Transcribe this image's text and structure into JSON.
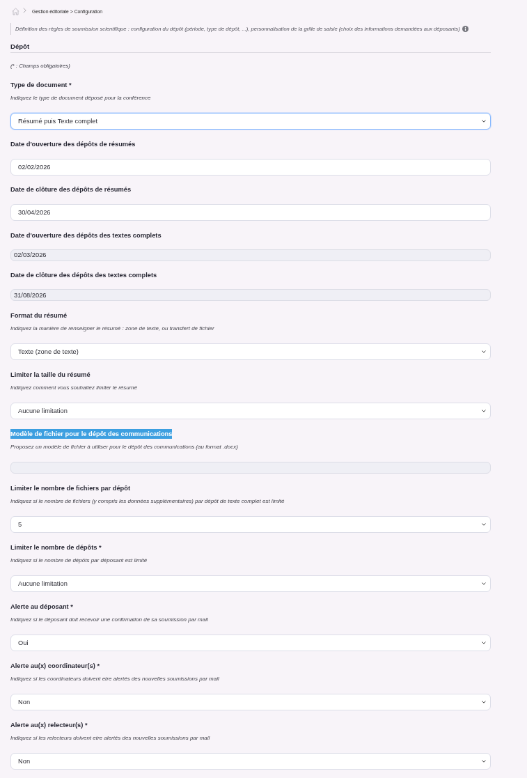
{
  "breadcrumb": {
    "path": "Gestion éditoriale > Configuration"
  },
  "description": {
    "text": "Définition des règles de soumission scientifique : configuration du dépôt (période, type de dépôt, ...), personnalisation de la grille de saisie (choix des informations demandées aux déposants)"
  },
  "section": {
    "title": "Dépôt",
    "note": "(* : Champs obligatoires)"
  },
  "fields": [
    {
      "kind": "select",
      "label": "Type de document *",
      "help": "Indiquez le type de document déposé pour la conférence",
      "value": "Résumé puis Texte complet",
      "disabled": false,
      "focused": true,
      "highlighted": false
    },
    {
      "kind": "date",
      "label": "Date d'ouverture des dépôts de résumés",
      "value": "02/02/2026",
      "disabled": false,
      "focused": false,
      "highlighted": false
    },
    {
      "kind": "date",
      "label": "Date de clôture des dépôts de résumés",
      "value": "30/04/2026",
      "disabled": false,
      "focused": false,
      "highlighted": false
    },
    {
      "kind": "date",
      "label": "Date d'ouverture des dépôts des textes complets",
      "value": "02/03/2026",
      "disabled": true,
      "focused": false,
      "highlighted": false
    },
    {
      "kind": "date",
      "label": "Date de clôture des dépôts des textes complets",
      "value": "31/08/2026",
      "disabled": true,
      "focused": false,
      "highlighted": false
    },
    {
      "kind": "select",
      "label": "Format du résumé",
      "help": "Indiquez la manière de renseigner le résumé : zone de texte, ou transfert de fichier",
      "value": "Texte (zone de texte)",
      "disabled": false,
      "focused": false,
      "highlighted": false
    },
    {
      "kind": "select",
      "label": "Limiter la taille du résumé",
      "help": "Indiquez comment vous souhaitez limiter le résumé",
      "value": "Aucune limitation",
      "disabled": false,
      "focused": false,
      "highlighted": false
    },
    {
      "kind": "file",
      "label": "Modèle de fichier pour le dépôt des communications",
      "help": "Proposez un modèle de fichier à utiliser pour le dépôt des communications (au format .docx)",
      "disabled": true,
      "focused": false,
      "highlighted": true
    },
    {
      "kind": "select",
      "label": "Limiter le nombre de fichiers par dépôt",
      "help": "Indiquez si le nombre de fichiers (y compris les données supplémentaires) par dépôt de texte complet est limité",
      "value": "5",
      "disabled": false,
      "focused": false,
      "highlighted": false
    },
    {
      "kind": "select",
      "label": "Limiter le nombre de dépôts *",
      "help": "Indiquez si le nombre de dépôts par déposant est limité",
      "value": "Aucune limitation",
      "disabled": false,
      "focused": false,
      "highlighted": false
    },
    {
      "kind": "select",
      "label": "Alerte au déposant *",
      "help": "Indiquez si le déposant doit recevoir une confirmation de sa soumission par mail",
      "value": "Oui",
      "disabled": false,
      "focused": false,
      "highlighted": false
    },
    {
      "kind": "select",
      "label": "Alerte au(x) coordinateur(s) *",
      "help": "Indiquez si les coordinateurs doivent etre alertés des nouvelles soumissions par mail",
      "value": "Non",
      "disabled": false,
      "focused": false,
      "highlighted": false
    },
    {
      "kind": "select",
      "label": "Alerte au(x) relecteur(s) *",
      "help": "Indiquez si les relecteurs doivent etre alertés des nouvelles soumissions par mail",
      "value": "Non",
      "disabled": false,
      "focused": false,
      "highlighted": false
    }
  ]
}
